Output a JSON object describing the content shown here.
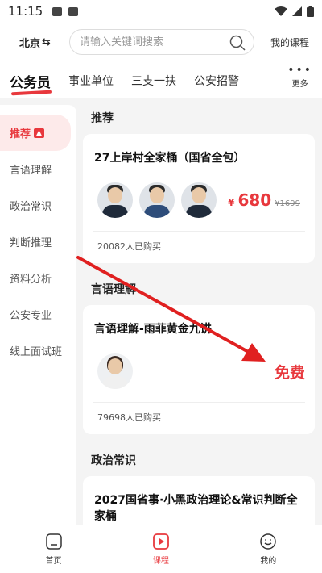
{
  "status_bar": {
    "time": "11:15"
  },
  "header": {
    "city": "北京",
    "city_switch_glyph": "⇆",
    "search_placeholder": "请输入关键词搜索",
    "my_courses": "我的课程"
  },
  "category_tabs": {
    "items": [
      "公务员",
      "事业单位",
      "三支一扶",
      "公安招警"
    ],
    "active_index": 0,
    "more_label": "更多"
  },
  "sidebar": {
    "items": [
      "推荐",
      "言语理解",
      "政治常识",
      "判断推理",
      "资料分析",
      "公安专业",
      "线上面试班"
    ],
    "active_index": 0,
    "hot_badge_glyph": "▲"
  },
  "sections": [
    {
      "title": "推荐",
      "card": {
        "title": "27上岸村全家桶（国省全包）",
        "price_symbol": "¥",
        "price": "680",
        "original_price": "¥1699",
        "buyers": "20082人已购买"
      }
    },
    {
      "title": "言语理解",
      "card": {
        "title": "言语理解-雨菲黄金九讲",
        "price_label": "免费",
        "buyers": "79698人已购买"
      }
    },
    {
      "title": "政治常识",
      "card": {
        "title": "2027国省事·小黑政治理论&常识判断全家桶"
      }
    }
  ],
  "bottom_nav": {
    "items": [
      "首页",
      "课程",
      "我的"
    ],
    "active_index": 1
  },
  "colors": {
    "accent": "#e8383d",
    "background": "#f4f4f4"
  }
}
